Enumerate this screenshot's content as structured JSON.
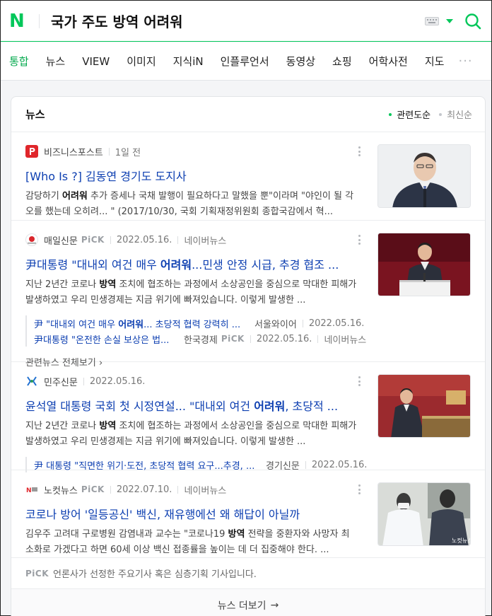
{
  "header": {
    "logo": "N",
    "query": "국가 주도 방역 어려워",
    "icons": {
      "keyboard": "keyboard-icon",
      "dropdown": "caret-down-icon",
      "search": "search-icon"
    },
    "colors": {
      "brand": "#03c75a",
      "link": "#0d3fb1"
    }
  },
  "tabs": [
    {
      "label": "통합",
      "active": true
    },
    {
      "label": "뉴스"
    },
    {
      "label": "VIEW"
    },
    {
      "label": "이미지"
    },
    {
      "label": "지식iN"
    },
    {
      "label": "인플루언서"
    },
    {
      "label": "동영상"
    },
    {
      "label": "쇼핑"
    },
    {
      "label": "어학사전"
    },
    {
      "label": "지도"
    }
  ],
  "tabs_more": "···",
  "news": {
    "title": "뉴스",
    "sort": {
      "relevance": "관련도순",
      "latest": "최신순"
    },
    "pick_label": "PiCK",
    "items": [
      {
        "press": "비즈니스포스트",
        "date": "1일 전",
        "headline": "[Who Is ?] 김동연 경기도 도지사",
        "summary_parts": [
          "감당하기 ",
          "어려워",
          " 추가 증세나 국채 발행이 필요하다고 말했을 뿐\"이라며 \"야인이 될 각오를 했는데 오히려... \" (2017/10/30, 국회 기획재정위원회 종합국감에서 혁..."
        ]
      },
      {
        "press": "매일신문",
        "pick": "PiCK",
        "date": "2022.05.16.",
        "source": "네이버뉴스",
        "headline_parts": [
          "尹대통령 \"대내외 여건 매우 ",
          "어려워",
          "...민생 안정 시급, 추경 협조 ..."
        ],
        "summary_parts": [
          "지난 2년간 코로나 ",
          "방역",
          " 조치에 협조하는 과정에서 소상공인을 중심으로 막대한 피해가 발생하였고 우리 민생경제는 지금 위기에 빠져있습니다. 이렇게 발생한 ..."
        ],
        "related": [
          {
            "title_parts": [
              "尹 \"대내외 여건 매우 ",
              "어려워",
              "... 초당적 협력 강력히 ..."
            ],
            "press": "서울와이어",
            "date": "2022.05.16."
          },
          {
            "title": "尹대통령 \"온전한 손실 보상은 법...",
            "press": "한국경제",
            "pick": "PiCK",
            "date": "2022.05.16.",
            "source": "네이버뉴스"
          }
        ],
        "related_all": "관련뉴스 전체보기"
      },
      {
        "press": "민주신문",
        "date": "2022.05.16.",
        "headline_parts": [
          "윤석열 대통령 국회 첫 시정연설... \"대내외 여건 ",
          "어려워",
          ", 초당적 ..."
        ],
        "summary_parts": [
          "지난 2년간 코로나 ",
          "방역",
          " 조치에 협조하는 과정에서 소상공인을 중심으로 막대한 피해가 발생하였고 우리 민생경제는 지금 위기에 빠져있습니다. 이렇게 발생한 ..."
        ],
        "related": [
          {
            "title": "尹 대통령 \"직면한 위기·도전, 초당적 협력 요구...추경, ...",
            "press": "경기신문",
            "date": "2022.05.16."
          }
        ]
      },
      {
        "press": "노컷뉴스",
        "pick": "PiCK",
        "date": "2022.07.10.",
        "source": "네이버뉴스",
        "headline": "코로나 방어 '일등공신' 백신, 재유행에선 왜 해답이 아닐까",
        "summary_parts": [
          "김우주 고려대 구로병원 감염내과 교수는 \"코로나19 ",
          "방역",
          " 전략을 중환자와 사망자 최소화로 가겠다고 하면 60세 이상 백신 접종률을 높이는 데 더 집중해야 한다. ..."
        ]
      }
    ],
    "footer_note": "언론사가 선정한 주요기사 혹은 심층기획 기사입니다.",
    "more": "뉴스 더보기",
    "more_arrow": "→",
    "related_arrow": "›"
  }
}
